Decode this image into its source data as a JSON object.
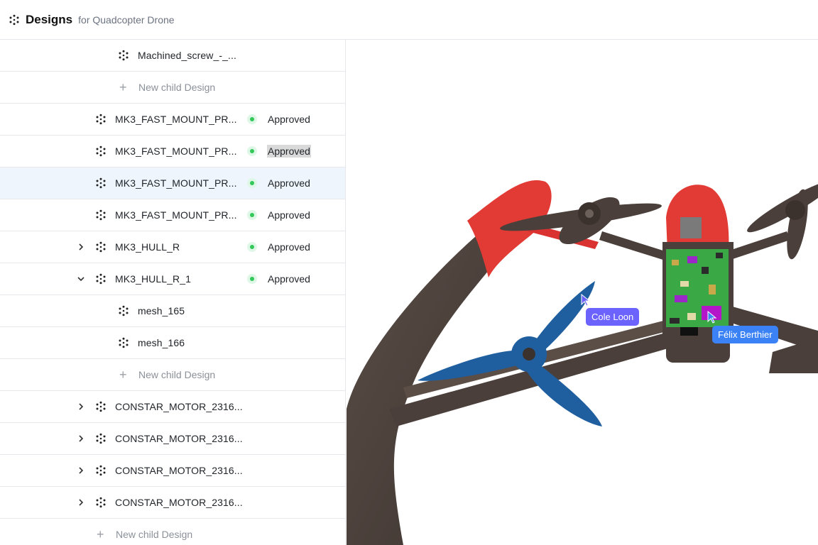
{
  "header": {
    "title": "Designs",
    "subtitle": "for Quadcopter Drone",
    "icon": "component-icon"
  },
  "tree": {
    "rows": [
      {
        "kind": "item",
        "name": "Machined_screw_-_...",
        "indent": 2,
        "chevron": "none",
        "status": ""
      },
      {
        "kind": "new",
        "label": "New child Design",
        "indent": 2
      },
      {
        "kind": "item",
        "name": "MK3_FAST_MOUNT_PR...",
        "indent": 1,
        "chevron": "none",
        "status": "Approved"
      },
      {
        "kind": "item",
        "name": "MK3_FAST_MOUNT_PR...",
        "indent": 1,
        "chevron": "none",
        "status": "Approved",
        "status_highlight": true
      },
      {
        "kind": "item",
        "name": "MK3_FAST_MOUNT_PR...",
        "indent": 1,
        "chevron": "none",
        "status": "Approved",
        "selected": true
      },
      {
        "kind": "item",
        "name": "MK3_FAST_MOUNT_PR...",
        "indent": 1,
        "chevron": "none",
        "status": "Approved"
      },
      {
        "kind": "item",
        "name": "MK3_HULL_R",
        "indent": 1,
        "chevron": "right",
        "status": "Approved"
      },
      {
        "kind": "item",
        "name": "MK3_HULL_R_1",
        "indent": 1,
        "chevron": "down",
        "status": "Approved"
      },
      {
        "kind": "item",
        "name": "mesh_165",
        "indent": 2,
        "chevron": "none",
        "status": ""
      },
      {
        "kind": "item",
        "name": "mesh_166",
        "indent": 2,
        "chevron": "none",
        "status": ""
      },
      {
        "kind": "new",
        "label": "New child Design",
        "indent": 2
      },
      {
        "kind": "item",
        "name": "CONSTAR_MOTOR_2316...",
        "indent": 1,
        "chevron": "right",
        "status": ""
      },
      {
        "kind": "item",
        "name": "CONSTAR_MOTOR_2316...",
        "indent": 1,
        "chevron": "right",
        "status": ""
      },
      {
        "kind": "item",
        "name": "CONSTAR_MOTOR_2316...",
        "indent": 1,
        "chevron": "right",
        "status": ""
      },
      {
        "kind": "item",
        "name": "CONSTAR_MOTOR_2316...",
        "indent": 1,
        "chevron": "right",
        "status": ""
      },
      {
        "kind": "new",
        "label": "New child Design",
        "indent": 1
      }
    ]
  },
  "viewport": {
    "collaborators": [
      {
        "name": "Cole Loon",
        "color": "#6c63ff"
      },
      {
        "name": "Félix Berthier",
        "color": "#3b82f6"
      }
    ],
    "colors": {
      "frame": "#4a3f3a",
      "red": "#e53935",
      "blue": "#1f5fa0",
      "pcb": "#3aa845"
    }
  }
}
